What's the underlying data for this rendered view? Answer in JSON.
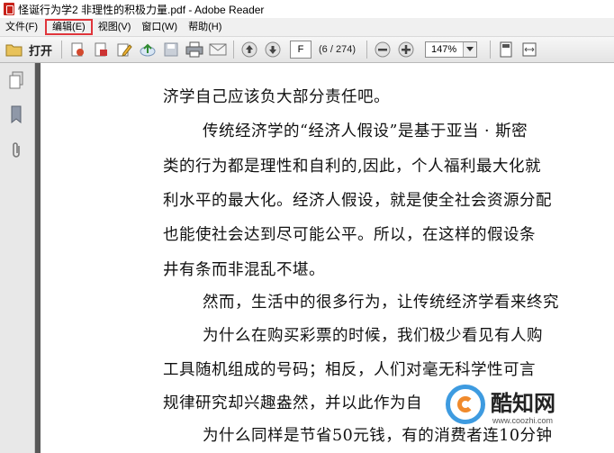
{
  "window": {
    "title": "怪诞行为学2 非理性的积极力量.pdf - Adobe Reader"
  },
  "menu": {
    "items": [
      {
        "label": "文件(F)"
      },
      {
        "label": "编辑(E)"
      },
      {
        "label": "视图(V)"
      },
      {
        "label": "窗口(W)"
      },
      {
        "label": "帮助(H)"
      }
    ],
    "highlighted": "编辑(E)",
    "highlight_color": "#e0353b"
  },
  "toolbar": {
    "open_label": "打开",
    "page_input": "F",
    "page_count": "(6 / 274)",
    "zoom": "147%"
  },
  "document": {
    "lines": [
      "济学自己应该负大部分责任吧。",
      "传统经济学的“经济人假设”是基于亚当 · 斯密",
      "类的行为都是理性和自利的,因此，个人福利最大化就",
      "利水平的最大化。经济人假设，就是使全社会资源分配",
      "也能使社会达到尽可能公平。所以，在这样的假设条",
      "井有条而非混乱不堪。",
      "然而，生活中的很多行为，让传统经济学看来终究",
      "为什么在购买彩票的时候，我们极少看见有人购",
      "工具随机组成的号码；相反，人们对毫无科学性可言",
      "规律研究却兴趣盎然，并以此作为自",
      "为什么同样是节省50元钱，有的消费者连10分钟"
    ]
  },
  "watermark": {
    "brand": "酷知网",
    "url": "www.coozhi.com"
  }
}
